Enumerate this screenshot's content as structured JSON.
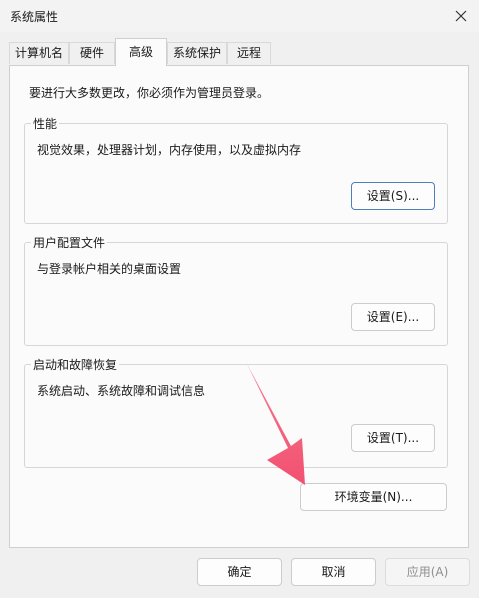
{
  "window": {
    "title": "系统属性"
  },
  "tabs": [
    {
      "label": "计算机名"
    },
    {
      "label": "硬件"
    },
    {
      "label": "高级",
      "active": true
    },
    {
      "label": "系统保护"
    },
    {
      "label": "远程"
    }
  ],
  "advanced": {
    "intro": "要进行大多数更改，你必须作为管理员登录。",
    "performance": {
      "label": "性能",
      "description": "视觉效果，处理器计划，内存使用，以及虚拟内存",
      "button": "设置(S)..."
    },
    "user_profiles": {
      "label": "用户配置文件",
      "description": "与登录帐户相关的桌面设置",
      "button": "设置(E)..."
    },
    "startup_recovery": {
      "label": "启动和故障恢复",
      "description": "系统启动、系统故障和调试信息",
      "button": "设置(T)..."
    },
    "env_vars_button": "环境变量(N)..."
  },
  "footer": {
    "ok": "确定",
    "cancel": "取消",
    "apply": "应用(A)"
  },
  "colors": {
    "arrow": "#f2506f",
    "focus_border": "#4f7fb8"
  }
}
